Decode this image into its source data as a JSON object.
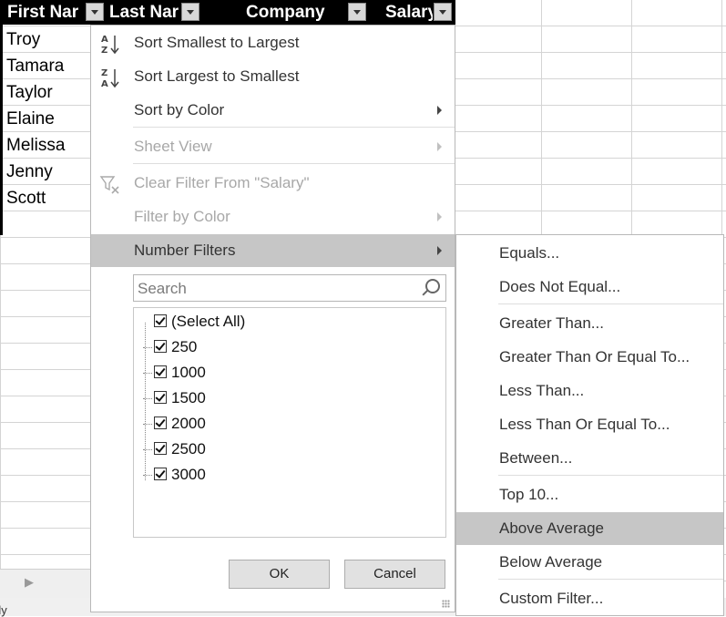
{
  "sheet": {
    "headers": [
      "First Nar",
      "Last Nar",
      "Company",
      "Salary"
    ],
    "names": [
      "Troy",
      "Tamara",
      "Taylor",
      "Elaine",
      "Melissa",
      "Jenny",
      "Scott"
    ],
    "status_text": "dy"
  },
  "menu": {
    "sort_asc": "Sort Smallest to Largest",
    "sort_desc": "Sort Largest to Smallest",
    "sort_color": "Sort by Color",
    "sheet_view": "Sheet View",
    "clear_filter": "Clear Filter From \"Salary\"",
    "filter_color": "Filter by Color",
    "number_filters": "Number Filters",
    "search_placeholder": "Search",
    "list": [
      "(Select All)",
      "250",
      "1000",
      "1500",
      "2000",
      "2500",
      "3000"
    ],
    "ok": "OK",
    "cancel": "Cancel"
  },
  "submenu": {
    "equals": "Equals...",
    "not_equal": "Does Not Equal...",
    "greater": "Greater Than...",
    "greater_eq": "Greater Than Or Equal To...",
    "less": "Less Than...",
    "less_eq": "Less Than Or Equal To...",
    "between": "Between...",
    "top10": "Top 10...",
    "above_avg": "Above Average",
    "below_avg": "Below Average",
    "custom": "Custom Filter..."
  },
  "colors": {
    "hover": "#c6c6c6",
    "header": "#000000",
    "disabled_text": "#a8a8a8"
  },
  "icons": [
    "sort-ascending-icon",
    "sort-descending-icon",
    "clear-filter-icon",
    "search-icon",
    "submenu-arrow-icon",
    "checkbox-icon"
  ]
}
